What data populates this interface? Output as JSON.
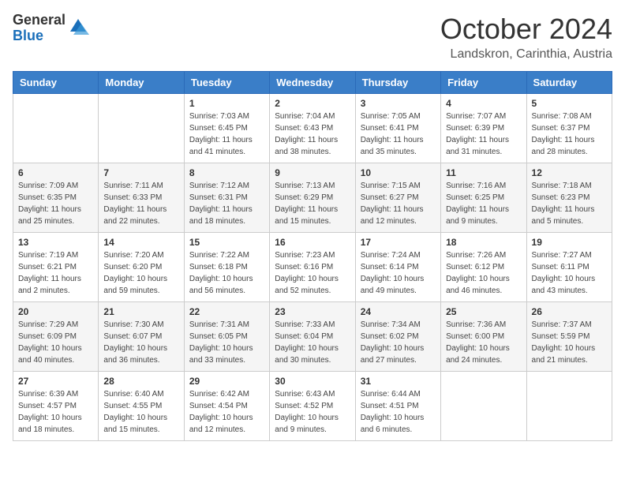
{
  "logo": {
    "general": "General",
    "blue": "Blue"
  },
  "header": {
    "title": "October 2024",
    "location": "Landskron, Carinthia, Austria"
  },
  "days_of_week": [
    "Sunday",
    "Monday",
    "Tuesday",
    "Wednesday",
    "Thursday",
    "Friday",
    "Saturday"
  ],
  "weeks": [
    [
      {
        "day": "",
        "sunrise": "",
        "sunset": "",
        "daylight": ""
      },
      {
        "day": "",
        "sunrise": "",
        "sunset": "",
        "daylight": ""
      },
      {
        "day": "1",
        "sunrise": "Sunrise: 7:03 AM",
        "sunset": "Sunset: 6:45 PM",
        "daylight": "Daylight: 11 hours and 41 minutes."
      },
      {
        "day": "2",
        "sunrise": "Sunrise: 7:04 AM",
        "sunset": "Sunset: 6:43 PM",
        "daylight": "Daylight: 11 hours and 38 minutes."
      },
      {
        "day": "3",
        "sunrise": "Sunrise: 7:05 AM",
        "sunset": "Sunset: 6:41 PM",
        "daylight": "Daylight: 11 hours and 35 minutes."
      },
      {
        "day": "4",
        "sunrise": "Sunrise: 7:07 AM",
        "sunset": "Sunset: 6:39 PM",
        "daylight": "Daylight: 11 hours and 31 minutes."
      },
      {
        "day": "5",
        "sunrise": "Sunrise: 7:08 AM",
        "sunset": "Sunset: 6:37 PM",
        "daylight": "Daylight: 11 hours and 28 minutes."
      }
    ],
    [
      {
        "day": "6",
        "sunrise": "Sunrise: 7:09 AM",
        "sunset": "Sunset: 6:35 PM",
        "daylight": "Daylight: 11 hours and 25 minutes."
      },
      {
        "day": "7",
        "sunrise": "Sunrise: 7:11 AM",
        "sunset": "Sunset: 6:33 PM",
        "daylight": "Daylight: 11 hours and 22 minutes."
      },
      {
        "day": "8",
        "sunrise": "Sunrise: 7:12 AM",
        "sunset": "Sunset: 6:31 PM",
        "daylight": "Daylight: 11 hours and 18 minutes."
      },
      {
        "day": "9",
        "sunrise": "Sunrise: 7:13 AM",
        "sunset": "Sunset: 6:29 PM",
        "daylight": "Daylight: 11 hours and 15 minutes."
      },
      {
        "day": "10",
        "sunrise": "Sunrise: 7:15 AM",
        "sunset": "Sunset: 6:27 PM",
        "daylight": "Daylight: 11 hours and 12 minutes."
      },
      {
        "day": "11",
        "sunrise": "Sunrise: 7:16 AM",
        "sunset": "Sunset: 6:25 PM",
        "daylight": "Daylight: 11 hours and 9 minutes."
      },
      {
        "day": "12",
        "sunrise": "Sunrise: 7:18 AM",
        "sunset": "Sunset: 6:23 PM",
        "daylight": "Daylight: 11 hours and 5 minutes."
      }
    ],
    [
      {
        "day": "13",
        "sunrise": "Sunrise: 7:19 AM",
        "sunset": "Sunset: 6:21 PM",
        "daylight": "Daylight: 11 hours and 2 minutes."
      },
      {
        "day": "14",
        "sunrise": "Sunrise: 7:20 AM",
        "sunset": "Sunset: 6:20 PM",
        "daylight": "Daylight: 10 hours and 59 minutes."
      },
      {
        "day": "15",
        "sunrise": "Sunrise: 7:22 AM",
        "sunset": "Sunset: 6:18 PM",
        "daylight": "Daylight: 10 hours and 56 minutes."
      },
      {
        "day": "16",
        "sunrise": "Sunrise: 7:23 AM",
        "sunset": "Sunset: 6:16 PM",
        "daylight": "Daylight: 10 hours and 52 minutes."
      },
      {
        "day": "17",
        "sunrise": "Sunrise: 7:24 AM",
        "sunset": "Sunset: 6:14 PM",
        "daylight": "Daylight: 10 hours and 49 minutes."
      },
      {
        "day": "18",
        "sunrise": "Sunrise: 7:26 AM",
        "sunset": "Sunset: 6:12 PM",
        "daylight": "Daylight: 10 hours and 46 minutes."
      },
      {
        "day": "19",
        "sunrise": "Sunrise: 7:27 AM",
        "sunset": "Sunset: 6:11 PM",
        "daylight": "Daylight: 10 hours and 43 minutes."
      }
    ],
    [
      {
        "day": "20",
        "sunrise": "Sunrise: 7:29 AM",
        "sunset": "Sunset: 6:09 PM",
        "daylight": "Daylight: 10 hours and 40 minutes."
      },
      {
        "day": "21",
        "sunrise": "Sunrise: 7:30 AM",
        "sunset": "Sunset: 6:07 PM",
        "daylight": "Daylight: 10 hours and 36 minutes."
      },
      {
        "day": "22",
        "sunrise": "Sunrise: 7:31 AM",
        "sunset": "Sunset: 6:05 PM",
        "daylight": "Daylight: 10 hours and 33 minutes."
      },
      {
        "day": "23",
        "sunrise": "Sunrise: 7:33 AM",
        "sunset": "Sunset: 6:04 PM",
        "daylight": "Daylight: 10 hours and 30 minutes."
      },
      {
        "day": "24",
        "sunrise": "Sunrise: 7:34 AM",
        "sunset": "Sunset: 6:02 PM",
        "daylight": "Daylight: 10 hours and 27 minutes."
      },
      {
        "day": "25",
        "sunrise": "Sunrise: 7:36 AM",
        "sunset": "Sunset: 6:00 PM",
        "daylight": "Daylight: 10 hours and 24 minutes."
      },
      {
        "day": "26",
        "sunrise": "Sunrise: 7:37 AM",
        "sunset": "Sunset: 5:59 PM",
        "daylight": "Daylight: 10 hours and 21 minutes."
      }
    ],
    [
      {
        "day": "27",
        "sunrise": "Sunrise: 6:39 AM",
        "sunset": "Sunset: 4:57 PM",
        "daylight": "Daylight: 10 hours and 18 minutes."
      },
      {
        "day": "28",
        "sunrise": "Sunrise: 6:40 AM",
        "sunset": "Sunset: 4:55 PM",
        "daylight": "Daylight: 10 hours and 15 minutes."
      },
      {
        "day": "29",
        "sunrise": "Sunrise: 6:42 AM",
        "sunset": "Sunset: 4:54 PM",
        "daylight": "Daylight: 10 hours and 12 minutes."
      },
      {
        "day": "30",
        "sunrise": "Sunrise: 6:43 AM",
        "sunset": "Sunset: 4:52 PM",
        "daylight": "Daylight: 10 hours and 9 minutes."
      },
      {
        "day": "31",
        "sunrise": "Sunrise: 6:44 AM",
        "sunset": "Sunset: 4:51 PM",
        "daylight": "Daylight: 10 hours and 6 minutes."
      },
      {
        "day": "",
        "sunrise": "",
        "sunset": "",
        "daylight": ""
      },
      {
        "day": "",
        "sunrise": "",
        "sunset": "",
        "daylight": ""
      }
    ]
  ]
}
